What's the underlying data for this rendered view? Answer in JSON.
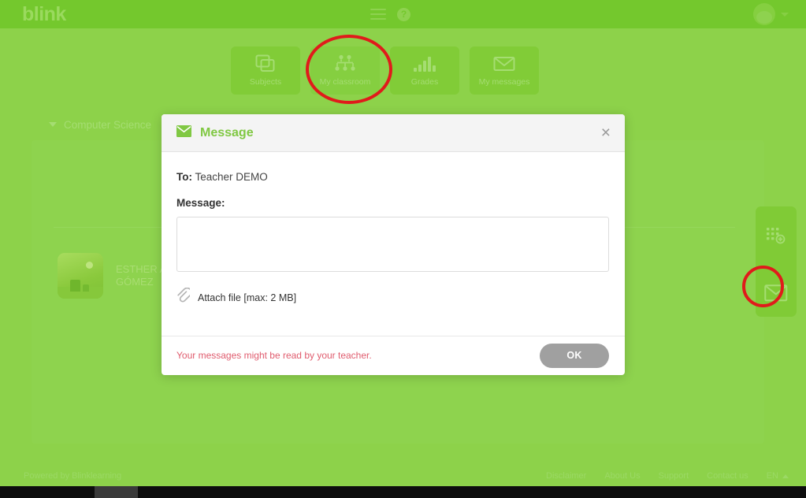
{
  "header": {
    "logo": "blink",
    "menu_icon": "hamburger-menu-icon",
    "help_icon": "?",
    "avatar_icon": "user-avatar"
  },
  "nav_tiles": [
    {
      "label": "Subjects",
      "icon": "layers-icon",
      "active": false
    },
    {
      "label": "My classroom",
      "icon": "org-chart-icon",
      "active": true
    },
    {
      "label": "Grades",
      "icon": "bar-chart-icon",
      "active": false
    },
    {
      "label": "My messages",
      "icon": "envelope-icon",
      "active": false
    }
  ],
  "content": {
    "subject_title": "Computer Science",
    "student_name": "ESTHER A GÓMEZ"
  },
  "right_rail": {
    "grid_add_label": "grid-add-icon",
    "messages_label": "envelope-icon"
  },
  "modal": {
    "title": "Message",
    "icon": "envelope-icon",
    "close_label": "×",
    "to_label": "To:",
    "to_value": "Teacher DEMO",
    "message_label": "Message:",
    "message_value": "",
    "message_placeholder": "",
    "attach_label": "Attach file [max: 2 MB]",
    "attach_icon": "paperclip-icon",
    "warning": "Your messages might be read by your teacher.",
    "ok_label": "OK"
  },
  "footer": {
    "powered_by": "Powered by Blinklearning",
    "links": [
      "Disclaimer",
      "About Us",
      "Support",
      "Contact us"
    ],
    "language": "EN"
  },
  "colors": {
    "background_green": "#8dd24a",
    "header_green": "#74c82d",
    "tile_green": "#81cc37",
    "accent_green": "#80c843",
    "warning_red": "#e05c6e",
    "annotation_red": "#e01b1b",
    "button_gray": "#a0a0a0"
  }
}
